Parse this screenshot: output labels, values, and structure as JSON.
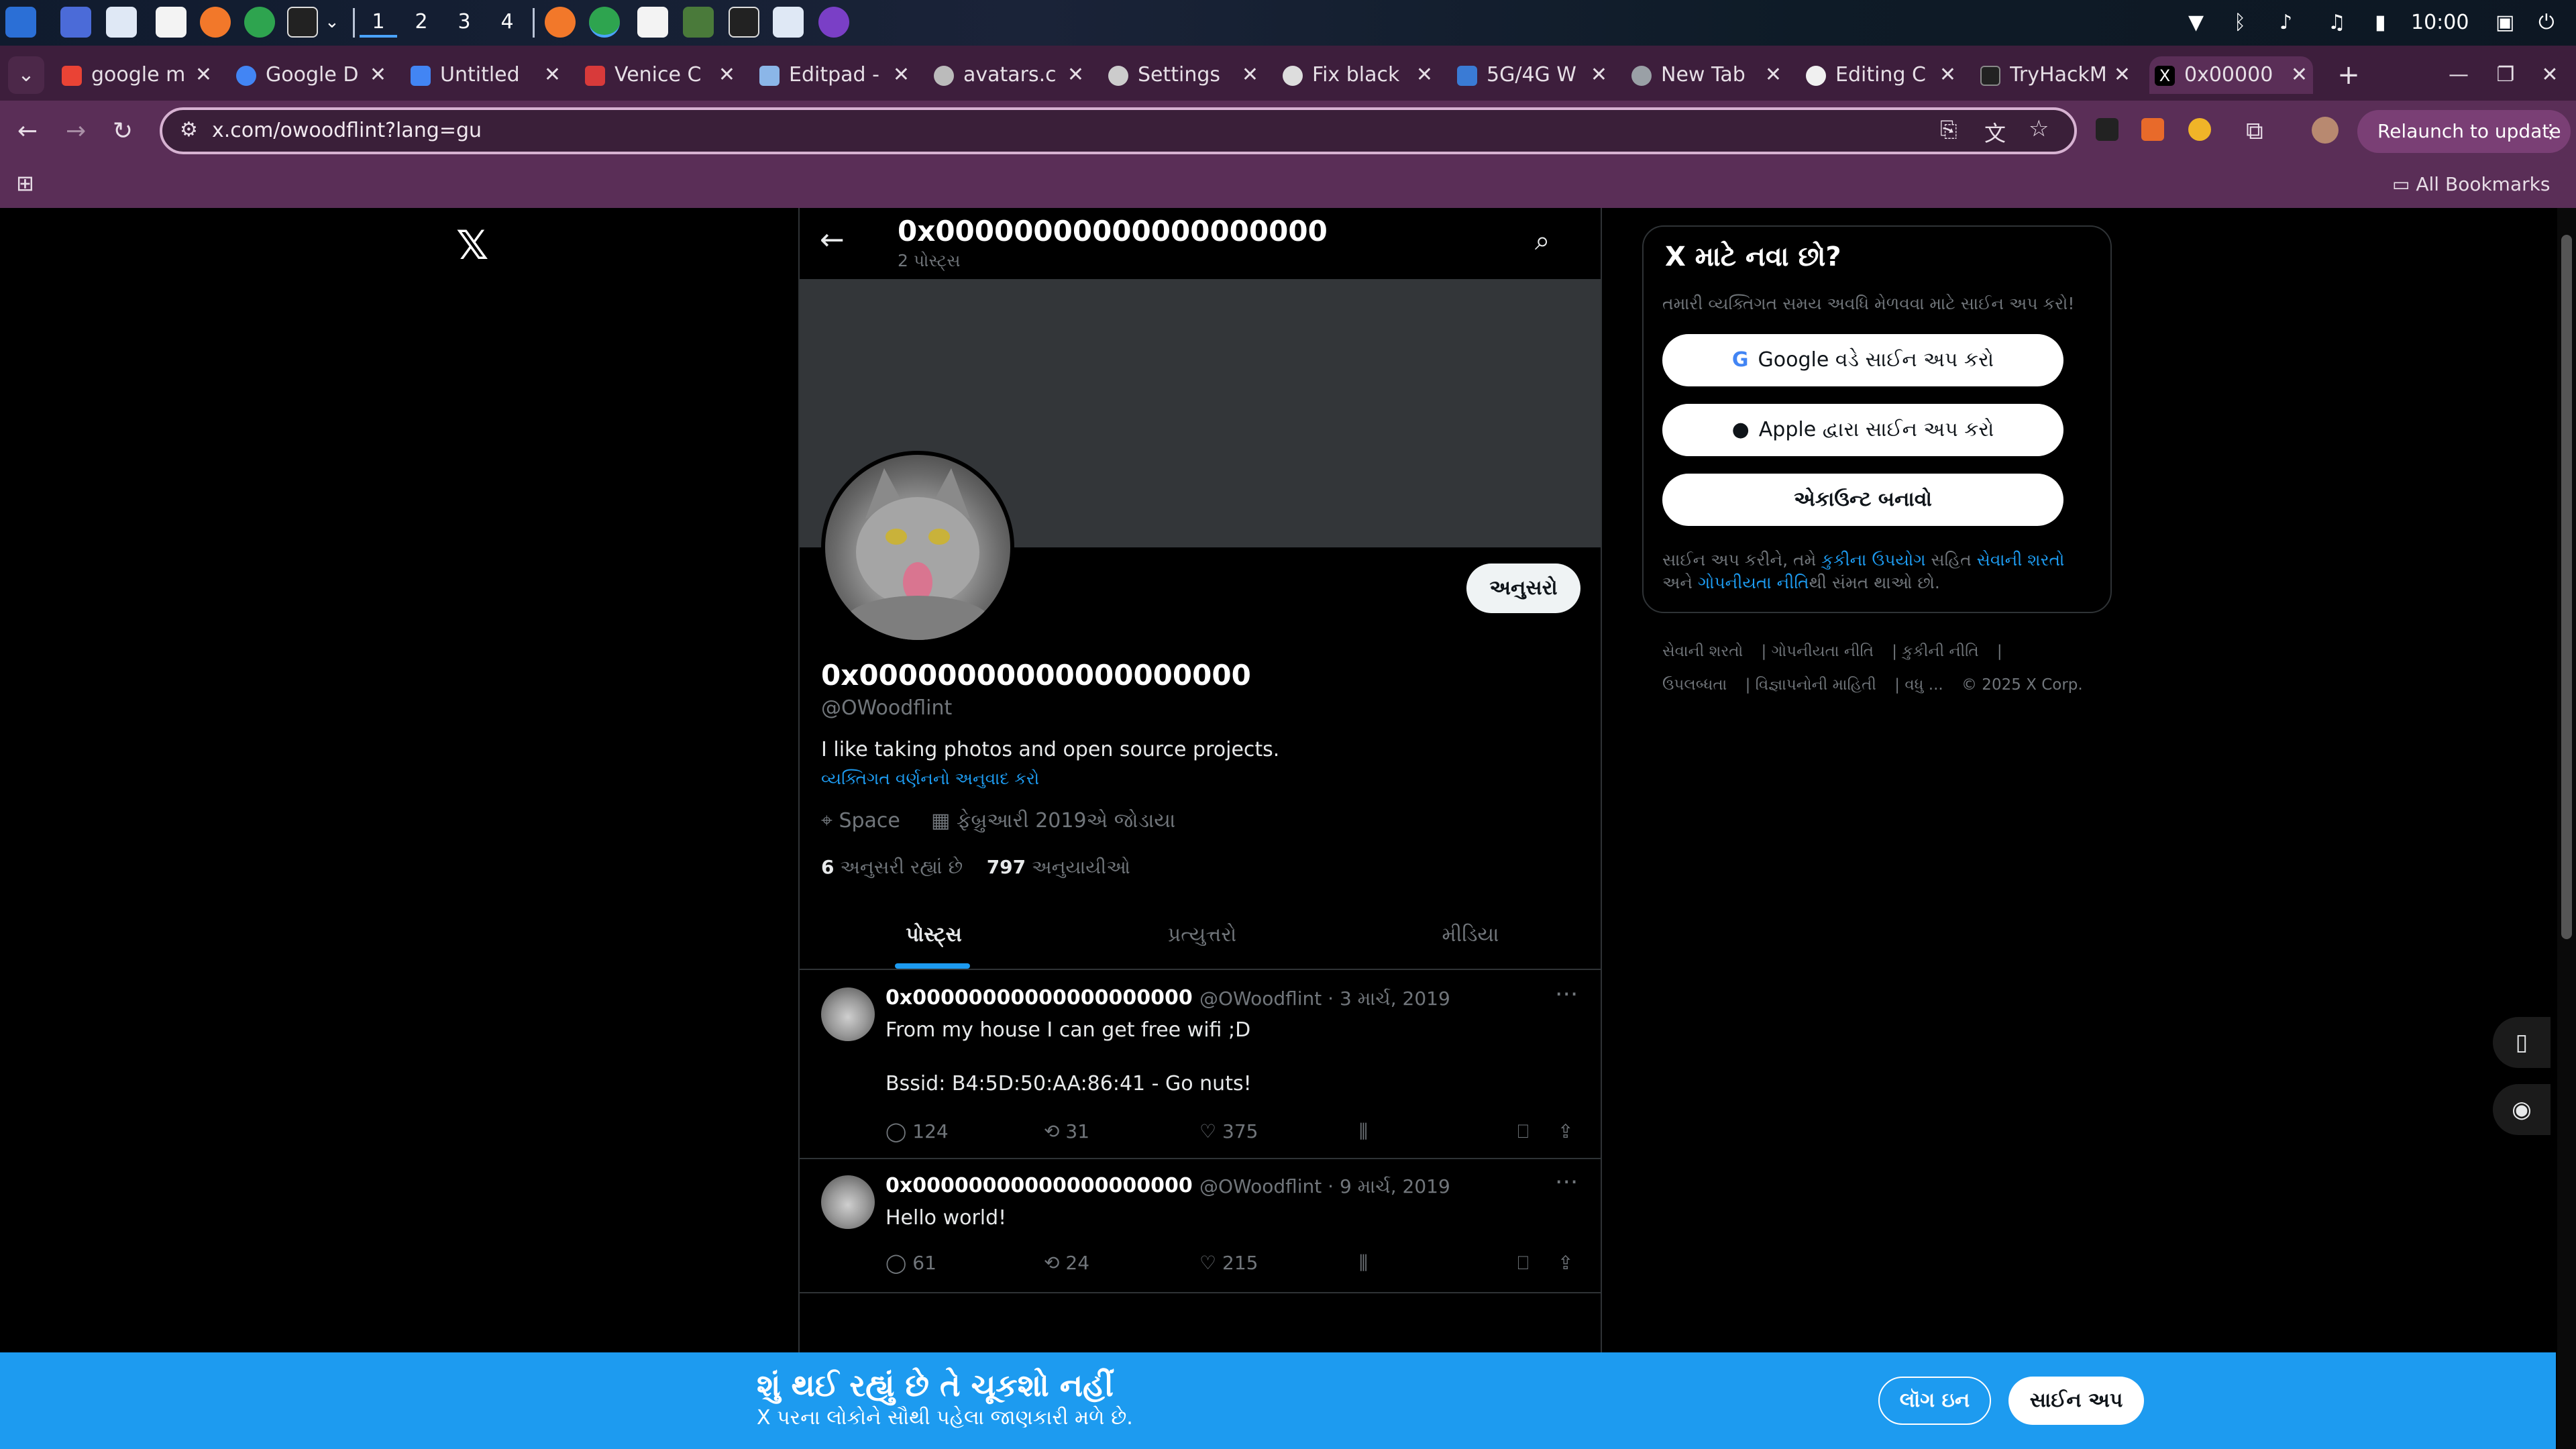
{
  "taskbar": {
    "workspaces": [
      "1",
      "2",
      "3",
      "4"
    ],
    "clock": "10:00"
  },
  "tabs": [
    {
      "label": "google m",
      "icon": "gmail-icon"
    },
    {
      "label": "Google D",
      "icon": "google-icon"
    },
    {
      "label": "Untitled",
      "icon": "docs-icon"
    },
    {
      "label": "Venice C",
      "icon": "venice-icon"
    },
    {
      "label": "Editpad -",
      "icon": "editpad-icon"
    },
    {
      "label": "avatars.c",
      "icon": "globe-icon"
    },
    {
      "label": "Settings",
      "icon": "gear-icon"
    },
    {
      "label": "Fix black",
      "icon": "openai-icon"
    },
    {
      "label": "5G/4G W",
      "icon": "network-icon"
    },
    {
      "label": "New Tab",
      "icon": "chrome-icon"
    },
    {
      "label": "Editing C",
      "icon": "github-icon"
    },
    {
      "label": "TryHackM",
      "icon": "tryhackme-icon"
    },
    {
      "label": "0x00000",
      "icon": "x-icon"
    }
  ],
  "toolbar": {
    "url": "x.com/owoodflint?lang=gu",
    "relaunch_label": "Relaunch to update"
  },
  "bookmarks": {
    "all_label": "All Bookmarks"
  },
  "header": {
    "name": "0x00000000000000000000",
    "post_count": "2 પોસ્ટ્સ"
  },
  "profile": {
    "follow_label": "અનુસરો",
    "name": "0x00000000000000000000",
    "handle": "@OWoodflint",
    "bio": "I like taking photos and open source projects.",
    "translate_label": "વ્યક્તિગત વર્ણનનો અનુવાદ કરો",
    "location": "Space",
    "joined": "ફેબ્રુઆરી 2019એ જોડાયા",
    "following_count": "6",
    "following_label": "અનુસરી રહ્યાં છે",
    "followers_count": "797",
    "followers_label": "અનુયાયીઓ"
  },
  "profile_tabs": [
    "પોસ્ટ્સ",
    "પ્રત્યુત્તરો",
    "મીડિયા"
  ],
  "posts": [
    {
      "name": "0x00000000000000000000",
      "handle": "@OWoodflint",
      "date": "3 માર્ચ, 2019",
      "line1": "From my house I can get free wifi ;D",
      "line2": "Bssid: B4:5D:50:AA:86:41 - Go nuts!",
      "replies": "124",
      "reposts": "31",
      "likes": "375"
    },
    {
      "name": "0x00000000000000000000",
      "handle": "@OWoodflint",
      "date": "9 માર્ચ, 2019",
      "line1": "Hello world!",
      "line2": "",
      "replies": "61",
      "reposts": "24",
      "likes": "215"
    }
  ],
  "signup": {
    "title": "X માટે નવા છો?",
    "subtitle": "તમારી વ્યક્તિગત સમય અવધિ મેળવવા માટે સાઈન અપ કરો!",
    "google_label": "Google વડે સાઈન અપ કરો",
    "apple_label": "Apple દ્વારા સાઈન અપ કરો",
    "create_label": "એકાઉન્ટ બનાવો",
    "legal_1": "સાઈન અપ કરીને, તમે ",
    "legal_cookie": "કુકીના ઉપયોગ",
    "legal_2": " સહિત ",
    "legal_terms": "સેવાની શરતો",
    "legal_3": " અને ",
    "legal_privacy": "ગોપનીયતા નીતિ",
    "legal_4": "થી સંમત થાઓ છો."
  },
  "footer": {
    "terms": "સેવાની શરતો",
    "privacy": "ગોપનીયતા નીતિ",
    "cookie": "કુકીની નીતિ",
    "accessibility": "ઉપલબ્ધતા",
    "ads": "વિજ્ઞાપનોની માહિતી",
    "more": "વધુ ...",
    "copyright": "© 2025 X Corp."
  },
  "bottom_bar": {
    "title": "શું થઈ રહ્યું છે તે ચૂકશો નહીં",
    "subtitle": "X પરના લોકોને સૌથી પહેલા જાણકારી મળે છે.",
    "login_label": "લૉગ ઇન",
    "signup_label": "સાઈન અપ"
  },
  "colors": {
    "accent": "#1d9bf0",
    "browser_frame": "#5a2e57"
  }
}
